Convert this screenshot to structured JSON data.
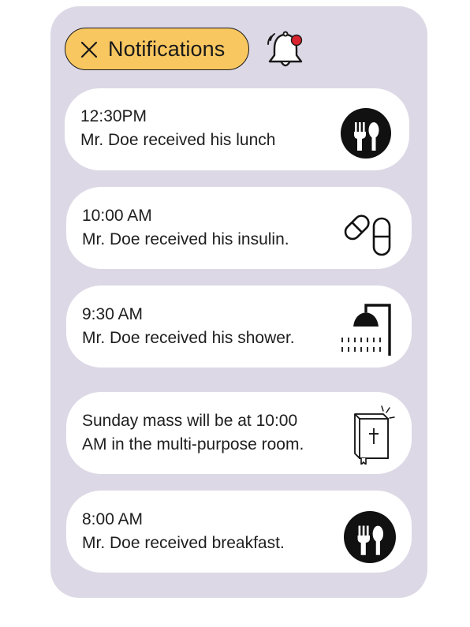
{
  "header": {
    "title": "Notifications",
    "close_icon": "close-icon",
    "bell_icon": "bell-icon",
    "pill_color": "#f8c760",
    "bell_badge_color": "#d9232e"
  },
  "panel_color": "#ddd8e6",
  "notifications": [
    {
      "line1": "12:30PM",
      "line2": "Mr. Doe received his lunch",
      "icon": "utensils-icon"
    },
    {
      "line1": "10:00 AM",
      "line2": "Mr. Doe received his insulin.",
      "icon": "pills-icon"
    },
    {
      "line1": "9:30 AM",
      "line2": "Mr. Doe received his shower.",
      "icon": "shower-icon"
    },
    {
      "line1": "Sunday mass will be at 10:00",
      "line2": "AM in the multi-purpose room.",
      "icon": "bible-icon"
    },
    {
      "line1": "8:00 AM",
      "line2": "Mr. Doe received breakfast.",
      "icon": "utensils-icon"
    }
  ]
}
